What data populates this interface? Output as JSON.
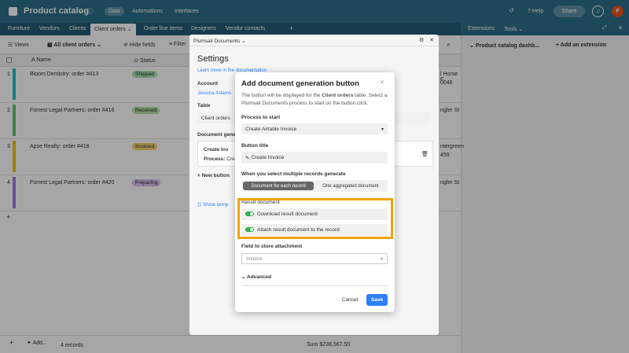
{
  "topbar": {
    "title": "Product catalog",
    "nav": [
      "Data",
      "Automations",
      "Interfaces"
    ],
    "help": "Help",
    "share": "Share",
    "avatar": "P"
  },
  "tables": [
    "Furniture",
    "Vendors",
    "Clients",
    "Client orders",
    "Order line items",
    "Designers",
    "Vendor contacts"
  ],
  "extensions": {
    "label": "Extensions",
    "tools": "Tools",
    "title": "Product catalog dashb...",
    "add": "Add an extension"
  },
  "toolbar": {
    "views": "Views",
    "view_name": "All client orders",
    "hide": "Hide fields",
    "filter": "Filter"
  },
  "columns": {
    "name": "Name",
    "status": "Status"
  },
  "rows": [
    {
      "num": "1",
      "name": "Bloom Dentistry: order #413",
      "status": "Shipped",
      "status_color": "#a8e3b8",
      "bar": "#20c2c2",
      "right1": "l Horse F",
      "right2": "0046"
    },
    {
      "num": "2",
      "name": "Forrest Legal Partners: order #416",
      "status": "Received",
      "status_color": "#b5e0a0",
      "bar": "#6bc26b",
      "right1": "ngler St",
      "right2": ""
    },
    {
      "num": "3",
      "name": "Apse Realty: order #418",
      "status": "Invoiced",
      "status_color": "#f5d36b",
      "bar": "#f0c419",
      "right1": "ntergreen",
      "right2": "459"
    },
    {
      "num": "4",
      "name": "Forrest Legal Partners: order #420",
      "status": "Preparing",
      "status_color": "#d8c2f0",
      "bar": "#9f7be0",
      "right1": "ngler St",
      "right2": ""
    }
  ],
  "footer": {
    "records": "4 records",
    "sum": "Sum $238,567.50",
    "add": "Add..."
  },
  "settings": {
    "window_title": "Plumsail Documents",
    "heading": "Settings",
    "learn": "Learn more in the documentation",
    "account_label": "Account",
    "account_value": "Jessica Adams",
    "table_label": "Table",
    "table_value": "Client orders",
    "docgen_label": "Document gene",
    "card_title": "Create Inv",
    "card_process": "Process:",
    "card_process_val": "Crea",
    "new_button": "New button",
    "show_templates": "Show temp"
  },
  "modal": {
    "title": "Add document generation button",
    "desc_pre": "The button will be displayed for the ",
    "desc_table": "Client orders",
    "desc_post": " table. Select a Plumsail Documents process to start on the button click.",
    "process_label": "Process to start",
    "process_value": "Create Airtable Invoice",
    "button_title_label": "Button title",
    "button_title_value": "Create Invoice",
    "multi_label": "When you select multiple records generate",
    "multi_opt1": "Document for each record",
    "multi_opt2": "One aggregated document",
    "result_label": "Result document",
    "toggle1": "Download result document",
    "toggle2": "Attach result document to the record",
    "field_label": "Field to store attachment",
    "field_value": "Invoice",
    "advanced": "Advanced",
    "cancel": "Cancel",
    "save": "Save"
  },
  "colors": {
    "accent": "#2d7ff9",
    "highlight": "#f0a30a",
    "topbar": "#2b6f8a"
  }
}
